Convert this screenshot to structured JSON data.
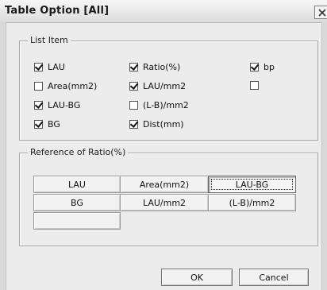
{
  "window": {
    "title": "Table Option [All]"
  },
  "list_item": {
    "label": "List Item",
    "items": [
      {
        "label": "LAU",
        "checked": true
      },
      {
        "label": "Area(mm2)",
        "checked": false
      },
      {
        "label": "LAU-BG",
        "checked": true
      },
      {
        "label": "BG",
        "checked": true
      },
      {
        "label": "Ratio(%)",
        "checked": true
      },
      {
        "label": "LAU/mm2",
        "checked": true
      },
      {
        "label": "(L-B)/mm2",
        "checked": false
      },
      {
        "label": "Dist(mm)",
        "checked": true
      },
      {
        "label": "bp",
        "checked": true
      },
      {
        "label": "",
        "checked": false
      }
    ]
  },
  "reference": {
    "label": "Reference of Ratio(%)",
    "buttons": [
      "LAU",
      "Area(mm2)",
      "LAU-BG",
      "BG",
      "LAU/mm2",
      "(L-B)/mm2",
      ""
    ],
    "selected": "LAU-BG"
  },
  "actions": {
    "ok": "OK",
    "cancel": "Cancel"
  }
}
